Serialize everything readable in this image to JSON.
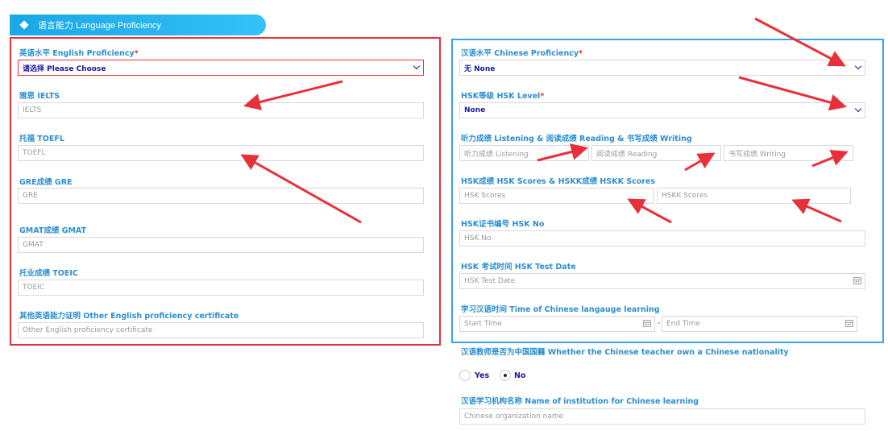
{
  "section": {
    "title": "语言能力 Language Proficiency"
  },
  "english": {
    "proficiency": {
      "label": "英语水平 English Proficiency",
      "required": "*",
      "value": "请选择 Please Choose"
    },
    "ielts": {
      "label": "雅思 IELTS",
      "placeholder": "IELTS"
    },
    "toefl": {
      "label": "托福 TOEFL",
      "placeholder": "TOEFL"
    },
    "gre": {
      "label": "GRE成绩 GRE",
      "placeholder": "GRE"
    },
    "gmat": {
      "label": "GMAT成绩 GMAT",
      "placeholder": "GMAT"
    },
    "toeic": {
      "label": "托业成绩 TOEIC",
      "placeholder": "TOEIC"
    },
    "other": {
      "label": "其他英语能力证明 Other English proficiency certificate",
      "placeholder": "Other English proficiency certificate"
    }
  },
  "chinese": {
    "proficiency": {
      "label": "汉语水平 Chinese Proficiency",
      "required": "*",
      "value": "无 None"
    },
    "hsk_level": {
      "label": "HSK等级 HSK Level",
      "required": "*",
      "value": "None"
    },
    "scores": {
      "label": "听力成绩 Listening & 阅读成绩 Reading & 书写成绩 Writing",
      "listening": "听力成绩 Listening",
      "reading": "阅读成绩 Reading",
      "writing": "书写成绩 Writing"
    },
    "hsk_scores": {
      "label": "HSK成绩 HSK Scores & HSKK成绩 HSKK Scores",
      "hsk": "HSK Scores",
      "hskk": "HSKK Scores"
    },
    "hsk_no": {
      "label": "HSK证书编号 HSK No",
      "placeholder": "HSK No"
    },
    "hsk_date": {
      "label": "HSK 考试时间 HSK Test Date",
      "placeholder": "HSK Test Date"
    },
    "learning_time": {
      "label": "学习汉语时间 Time of Chinese langauge learning",
      "start": "Start Time",
      "separator": "-",
      "end": "End Time"
    },
    "teacher_nationality": {
      "label": "汉语教师是否为中国国籍 Whether the Chinese teacher own a Chinese nationality",
      "yes": "Yes",
      "no": "No",
      "selected": "No"
    },
    "institution": {
      "label": "汉语学习机构名称 Name of institution for Chinese learning",
      "placeholder": "Chinese organization name"
    }
  },
  "colors": {
    "accent": "#29b6f0",
    "label": "#2c8fd1",
    "left_box": "#e8303a",
    "right_box": "#3aa2e6",
    "arrow": "#e8303a"
  }
}
